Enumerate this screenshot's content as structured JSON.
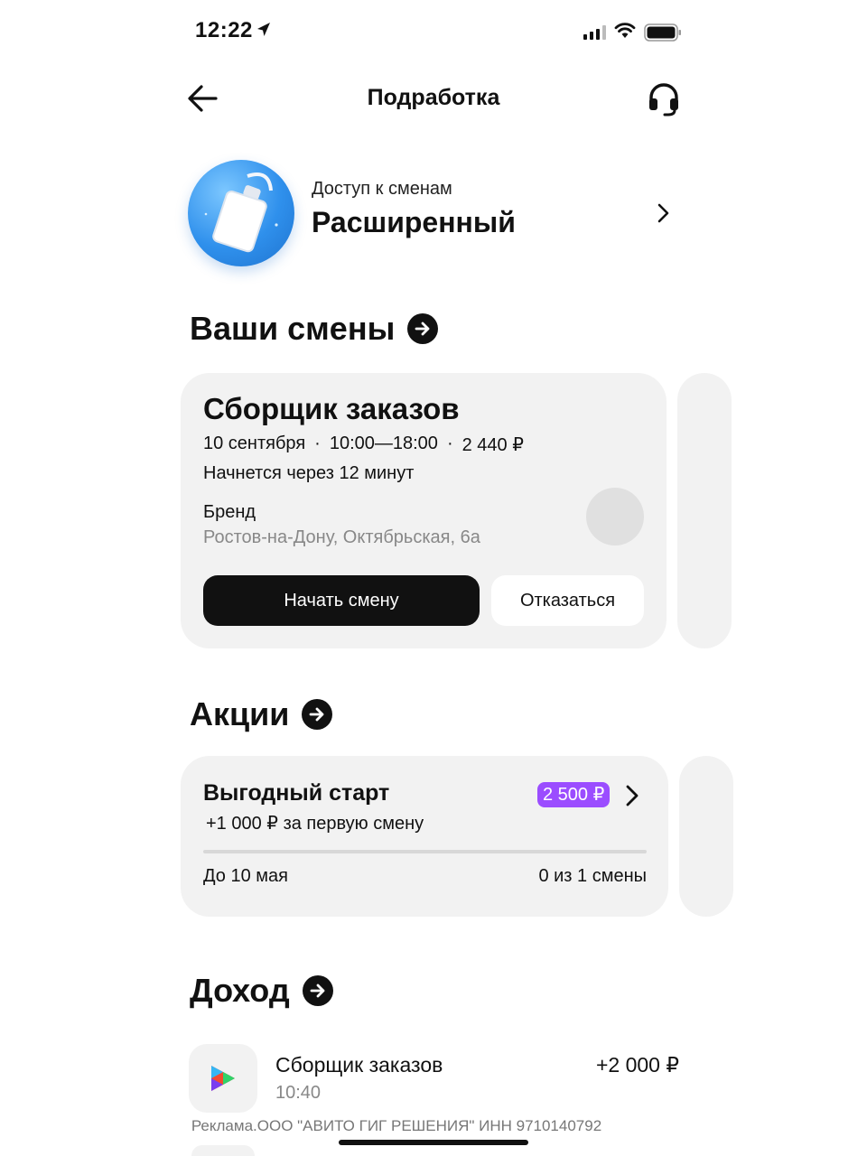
{
  "status_bar": {
    "time": "12:22"
  },
  "nav": {
    "title": "Подработка"
  },
  "access": {
    "subtitle": "Доступ к сменам",
    "level": "Расширенный"
  },
  "sections": {
    "shifts": "Ваши смены",
    "promos": "Акции",
    "income": "Доход"
  },
  "shift": {
    "title": "Сборщик заказов",
    "date": "10 сентября",
    "time": "10:00—18:00",
    "pay": "2 440 ₽",
    "starts_in": "Начнется через 12 минут",
    "brand": "Бренд",
    "address": "Ростов-на-Дону, Октябрьская, 6а",
    "start_button": "Начать смену",
    "decline_button": "Отказаться"
  },
  "promo": {
    "title": "Выгодный старт",
    "subtitle": "+1 000 ₽ за первую смену",
    "badge": "2 500 ₽",
    "deadline": "До 10 мая",
    "count": "0 из 1 смены",
    "progress": 0
  },
  "income_item": {
    "title": "Сборщик заказов",
    "time": "10:40",
    "amount": "+2 000 ₽"
  },
  "ad": "Реклама.ООО \"АВИТО ГИГ РЕШЕНИЯ\" ИНН 9710140792",
  "colors": {
    "accent": "#9b4dff",
    "badge_blue": "#2f90ec",
    "card_bg": "#f2f2f2"
  }
}
